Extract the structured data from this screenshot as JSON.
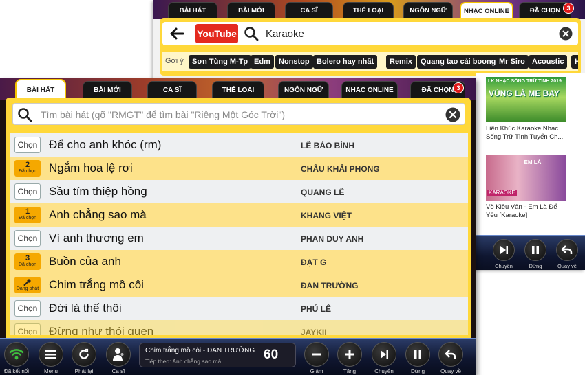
{
  "back": {
    "tabs": [
      "BÀI HÁT",
      "BÀI MỚI",
      "CA SĨ",
      "THỂ LOẠI",
      "NGÔN NGỮ",
      "NHẠC ONLINE",
      "ĐÃ CHỌN"
    ],
    "active_tab": "NHẠC ONLINE",
    "selected_badge": "3",
    "youtube_logo": "YouTube",
    "search_query": "Karaoke",
    "suggest_label": "Gợi ý",
    "suggestions": [
      "Sơn Tùng M-Tp",
      "Edm",
      "Nonstop",
      "Bolero hay nhất",
      "Remix",
      "Quang tao cải boong",
      "Mr Siro",
      "Acoustic",
      "Hồ"
    ],
    "videos": [
      {
        "thumb_line1": "LK NHẠC SỐNG TRỮ TÌNH 2019",
        "thumb_line2": "VÙNG LÁ ME BAY",
        "title": "Liên Khúc Karaoke Nhạc Sống Trữ Tình Tuyển Ch..."
      },
      {
        "thumb_line1": "EM LÀ",
        "thumb_line2": "KARAOKE",
        "title": "Võ Kiều Vân - Em Là Để Yêu [Karaoke]"
      }
    ],
    "controls": [
      {
        "icon": "skip-next-icon",
        "label": "Chuyển"
      },
      {
        "icon": "pause-icon",
        "label": "Dừng"
      },
      {
        "icon": "back-icon",
        "label": "Quay về"
      }
    ]
  },
  "front": {
    "tabs": [
      "BÀI HÁT",
      "BÀI MỚI",
      "CA SĨ",
      "THỂ LOẠI",
      "NGÔN NGỮ",
      "NHẠC ONLINE",
      "ĐÃ CHỌN"
    ],
    "active_tab": "BÀI HÁT",
    "selected_badge": "3",
    "search_placeholder": "Tìm bài hát (gõ \"RMGT\" để tìm bài \"Riêng Một Góc Trời\")",
    "songs": [
      {
        "state": "plain",
        "button": "Chọn",
        "title": "Để cho anh khóc (rm)",
        "artist": "LÊ BẢO BÌNH"
      },
      {
        "state": "chosen",
        "num": "2",
        "button": "Đã chọn",
        "title": "Ngắm hoa lệ rơi",
        "artist": "CHÂU KHẢI PHONG"
      },
      {
        "state": "plain",
        "button": "Chọn",
        "title": "Sầu tím thiệp hồng",
        "artist": "QUANG LÊ"
      },
      {
        "state": "chosen",
        "num": "1",
        "button": "Đã chọn",
        "title": "Anh chẳng sao mà",
        "artist": "KHANG VIỆT"
      },
      {
        "state": "plain",
        "button": "Chọn",
        "title": "Vì anh thương em",
        "artist": "PHAN DUY ANH"
      },
      {
        "state": "chosen",
        "num": "3",
        "button": "Đã chọn",
        "title": "Buồn của anh",
        "artist": "ĐẠT G"
      },
      {
        "state": "playing",
        "button": "Đang phát",
        "title": "Chim trắng mồ côi",
        "artist": "ĐAN TRƯỜNG"
      },
      {
        "state": "plain",
        "button": "Chọn",
        "title": "Đời là thế thôi",
        "artist": "PHÚ LÊ"
      },
      {
        "state": "plain",
        "button": "Chọn",
        "title": "Đừng như thói quen",
        "artist": "JAYKII"
      }
    ],
    "now_playing": {
      "title": "Chim trắng mồ côi - ĐAN TRƯỜNG",
      "next": "Tiếp theo: Anh chẳng sao mà",
      "count": "60"
    },
    "controls": [
      {
        "icon": "wifi-icon",
        "label": "Đã kết nối"
      },
      {
        "icon": "menu-icon",
        "label": "Menu"
      },
      {
        "icon": "replay-icon",
        "label": "Phát lại"
      },
      {
        "icon": "singer-icon",
        "label": "Ca sĩ"
      },
      {
        "icon": "minus-icon",
        "label": "Giảm"
      },
      {
        "icon": "plus-icon",
        "label": "Tăng"
      },
      {
        "icon": "skip-next-icon",
        "label": "Chuyển"
      },
      {
        "icon": "pause-icon",
        "label": "Dừng"
      },
      {
        "icon": "back-icon",
        "label": "Quay về"
      }
    ]
  },
  "colors": {
    "panel_yellow": "#ffd83a",
    "row_selected": "#fde28a",
    "chosen_button": "#f5a800",
    "badge_red": "#e01818",
    "youtube_red": "#e42a1f"
  }
}
